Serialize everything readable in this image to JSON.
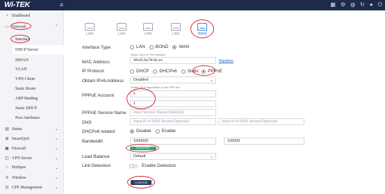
{
  "topbar": {
    "logo": "Wi-TEK",
    "menu_icon": "hamburger-icon",
    "icons": [
      "grid-icon",
      "gear-icon",
      "globe-icon",
      "refresh-icon",
      "user-icon",
      "power-icon"
    ]
  },
  "sidebar": {
    "items": [
      {
        "label": "Dashboard",
        "icon": "dashboard-icon"
      },
      {
        "label": "Network",
        "icon": "network-icon"
      },
      {
        "label": "Status",
        "icon": "status-icon"
      },
      {
        "label": "SmartQoS",
        "icon": "qos-icon"
      },
      {
        "label": "Firewall",
        "icon": "firewall-icon"
      },
      {
        "label": "VPN Server",
        "icon": "vpn-icon"
      },
      {
        "label": "HotSpot",
        "icon": "hotspot-icon"
      },
      {
        "label": "Wireless",
        "icon": "wireless-icon"
      },
      {
        "label": "CPE Management",
        "icon": "cpe-icon"
      }
    ],
    "network_sub": [
      "Interface",
      "DHCP Server",
      "MWAN",
      "VLAN",
      "VPN Client",
      "Static Route",
      "ARP Binding",
      "Static DHCP",
      "Port Attributes"
    ]
  },
  "tabs": [
    "LAN",
    "LAN",
    "LAN",
    "LAN",
    "WAN"
  ],
  "form": {
    "interface_type": {
      "label": "Interface Type",
      "options": [
        "LAN",
        "BOND",
        "WAN"
      ],
      "selected": "WAN"
    },
    "mac": {
      "label": "MAC Address",
      "hint": "Select Type of The Interface",
      "value": "44:d1:fa:7b:4c:ec",
      "link": "Random"
    },
    "ip_protocol": {
      "label": "IP Protocol",
      "options": [
        "DHCP",
        "DHCPv6",
        "Static",
        "PPPoE"
      ],
      "selected": "PPPoE"
    },
    "ipv6": {
      "label": "Obtain IPv6-Address",
      "value": "Disabled",
      "hint": "Enable IPv6 negotiation on the PPP link"
    },
    "pppoe_account": {
      "label": "PPPoE Account",
      "value": "1",
      "password_value": "1"
    },
    "service_name": {
      "label": "PPPoE Service Name",
      "placeholder": "Input Service Name(Optional)"
    },
    "dns": {
      "label": "DNS",
      "placeholder1": "Input IP of DNS Server(Optional)",
      "placeholder2": "Input IP of DNS Server(Optional)"
    },
    "dhcpv6": {
      "label": "DHCPv6 related",
      "options": [
        "Disable",
        "Enable"
      ],
      "selected": "Disable"
    },
    "bandwidth": {
      "label": "Bandwidth",
      "down": "1000000",
      "up": "100000",
      "button": "SPEEDTEST BANDWIDTH"
    },
    "load_balance": {
      "label": "Load Balance",
      "value": "Default"
    },
    "link_detection": {
      "label": "Link Detection",
      "toggle_label": "Enable Detection"
    },
    "confirm": "CONFIRM"
  },
  "colors": {
    "topbar": "#1e2a4a",
    "accent": "#3a7bd5",
    "highlight": "#d9232d",
    "confirm": "#2d3e66",
    "speedtest": "#2ea67a"
  }
}
